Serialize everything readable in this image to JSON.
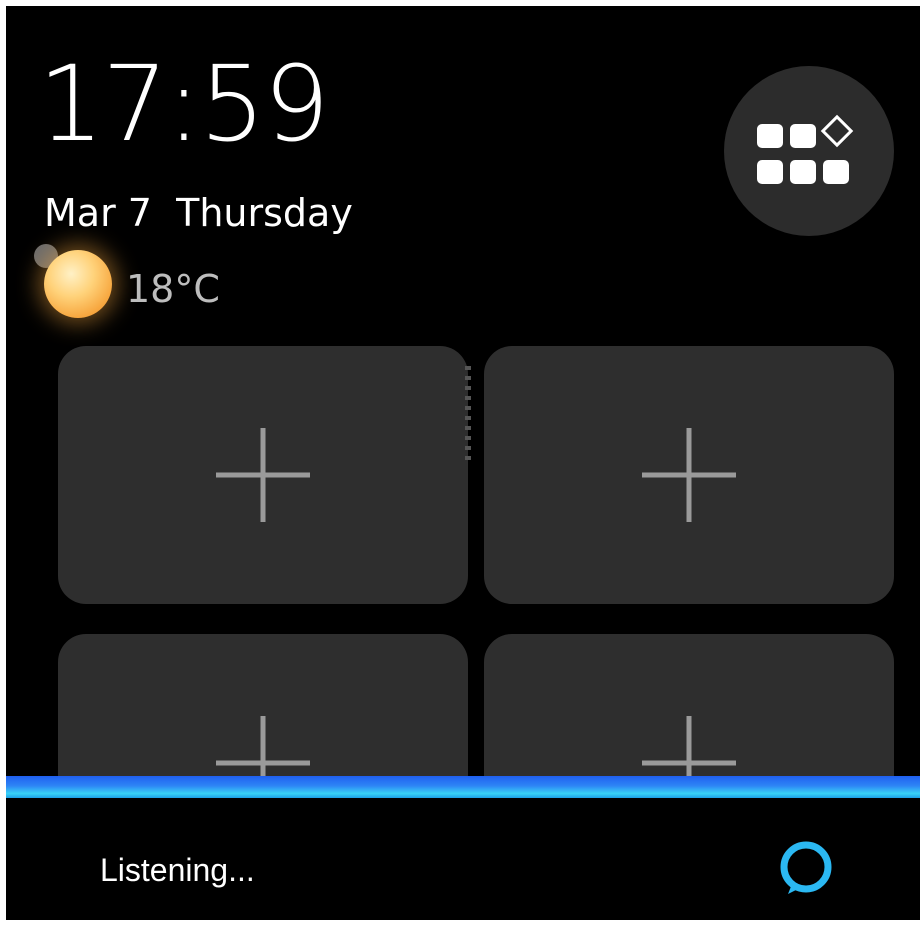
{
  "clock": {
    "time": "17:59"
  },
  "date": {
    "text": "Mar 7  Thursday"
  },
  "weather": {
    "icon": "sun-icon",
    "temperature": "18°C"
  },
  "apps_button": {
    "icon": "apps-grid-icon"
  },
  "tiles": [
    {
      "icon": "plus-icon"
    },
    {
      "icon": "plus-icon"
    },
    {
      "icon": "plus-icon"
    },
    {
      "icon": "plus-icon"
    }
  ],
  "voice": {
    "status": "Listening...",
    "icon": "alexa-ring-icon",
    "bar_colors": [
      "#1f5ff0",
      "#38d3f7"
    ],
    "ring_color": "#2bb8f2"
  },
  "colors": {
    "background": "#000000",
    "tile": "#2e2e2e",
    "apps_button": "#2c2c2c",
    "text": "#ffffff"
  }
}
